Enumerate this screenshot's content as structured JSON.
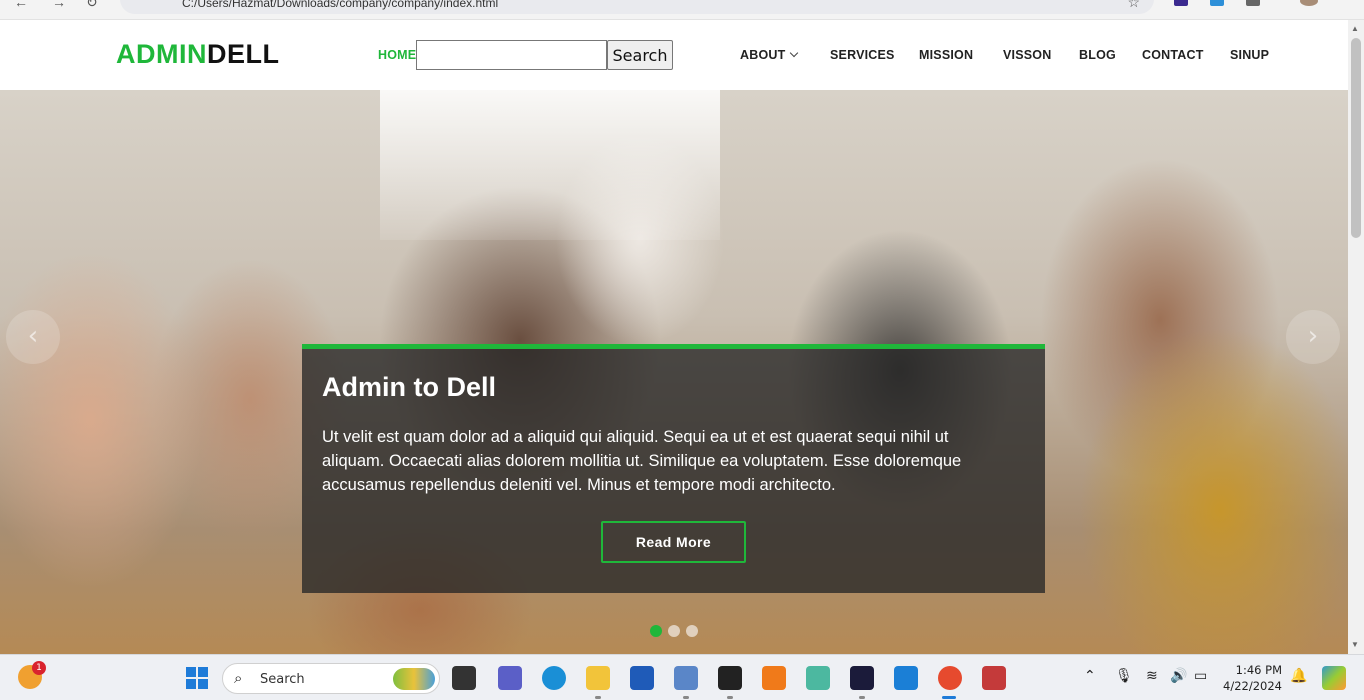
{
  "browser": {
    "url": "C:/Users/Hazmat/Downloads/company/company/index.html"
  },
  "header": {
    "logo_part1": "ADMIN",
    "logo_part2": "DELL",
    "nav": {
      "home": "HOME",
      "about": "ABOUT",
      "services": "SERVICES",
      "mission": "MISSION",
      "vision": "VISSON",
      "blog": "BLOG",
      "contact": "CONTACT",
      "signup": "SINUP"
    },
    "search": {
      "placeholder": "",
      "button_label": "Search"
    }
  },
  "hero": {
    "title": "Admin to Dell",
    "body": "Ut velit est quam dolor ad a aliquid qui aliquid. Sequi ea ut et est quaerat sequi nihil ut aliquam. Occaecati alias dolorem mollitia ut. Similique ea voluptatem. Esse doloremque accusamus repellendus deleniti vel. Minus et tempore modi architecto.",
    "button_label": "Read More",
    "prev_glyph": "‹",
    "next_glyph": "›",
    "slide_count": 3,
    "active_slide": 1
  },
  "colors": {
    "accent": "#1fb73a",
    "caption_bg": "#262626"
  },
  "taskbar": {
    "search_label": "Search",
    "notification_count": "1",
    "time": "1:46 PM",
    "date": "4/22/2024"
  }
}
